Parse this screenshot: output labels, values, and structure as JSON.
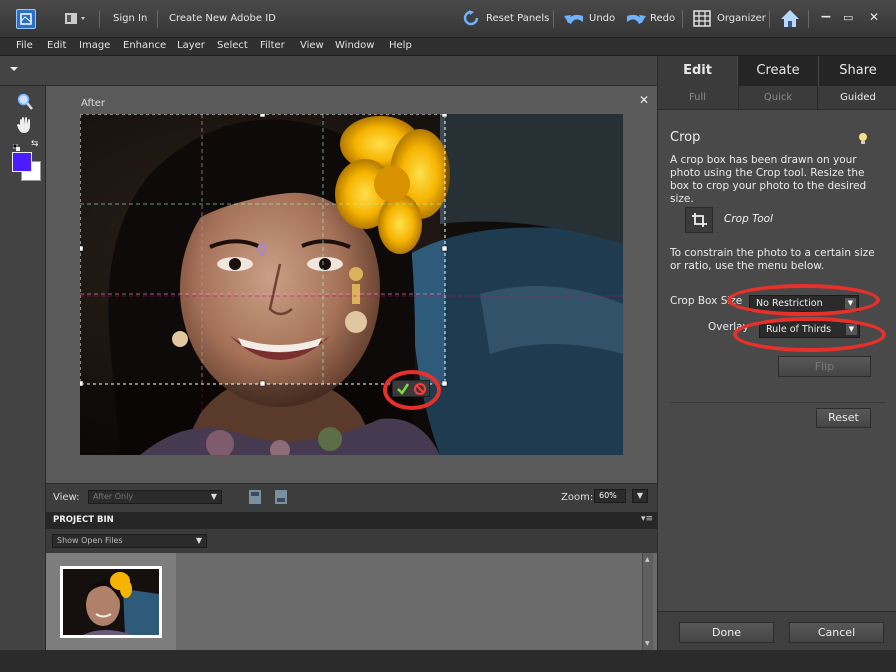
{
  "titlebar": {
    "sign_in": "Sign In",
    "create_id": "Create New Adobe ID",
    "reset_panels": "Reset Panels",
    "undo": "Undo",
    "redo": "Redo",
    "organizer": "Organizer",
    "window_controls": [
      "−",
      "▭",
      "✕"
    ]
  },
  "menus": [
    "File",
    "Edit",
    "Image",
    "Enhance",
    "Layer",
    "Select",
    "Filter",
    "View",
    "Window",
    "Help"
  ],
  "document": {
    "title": "After",
    "close": "✕"
  },
  "viewbar": {
    "view_label": "View:",
    "view_value": "After Only",
    "zoom_label": "Zoom:",
    "zoom_value": "60%"
  },
  "bin": {
    "header": "PROJECT BIN",
    "show": "Show Open Files"
  },
  "panel": {
    "tabs": [
      "Edit",
      "Create",
      "Share"
    ],
    "subtabs": [
      "Full",
      "Quick",
      "Guided"
    ],
    "heading": "Crop",
    "desc": "A crop box has been drawn on your photo using the Crop tool. Resize the box to crop your photo to the desired size.",
    "tool": "Crop Tool",
    "constrain": "To constrain the photo to a certain size or ratio, use the menu below.",
    "crop_box_label": "Crop Box Size",
    "crop_box_value": "No Restriction",
    "overlay_label": "Overlay",
    "overlay_value": "Rule of Thirds",
    "flip": "Flip",
    "reset": "Reset",
    "done": "Done",
    "cancel": "Cancel"
  },
  "colors": {
    "accent": "#e8302a",
    "foreground_swatch": "#4a1cff",
    "background_swatch": "#ffffff",
    "flower": "#f5b400"
  },
  "icons": [
    "zoom-icon",
    "hand-icon",
    "swap-colors-icon",
    "crop-tool-icon",
    "lightbulb-icon",
    "commit-check-icon",
    "cancel-crop-icon",
    "home-icon",
    "undo-icon",
    "redo-icon",
    "reset-panels-icon",
    "organizer-icon"
  ]
}
